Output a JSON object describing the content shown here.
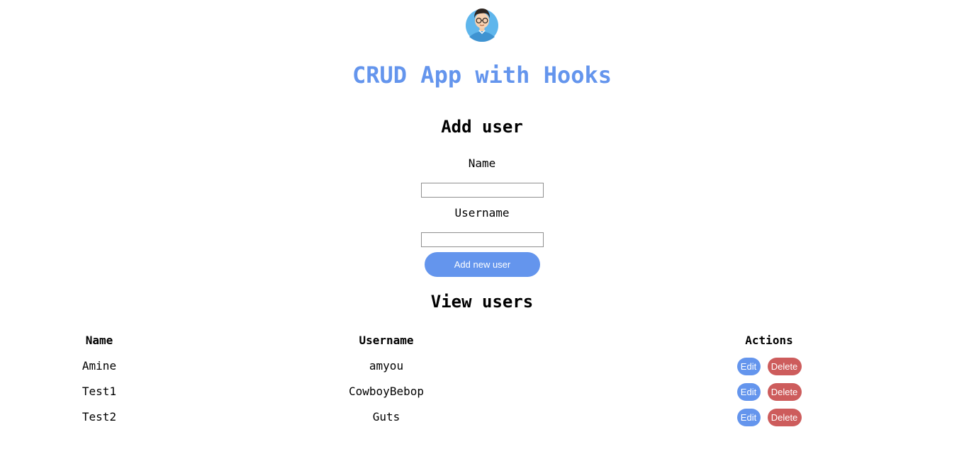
{
  "header": {
    "avatar_icon": "user-avatar-icon",
    "title": "CRUD App with Hooks",
    "accent_color": "#6495ed",
    "danger_color": "#cd5c5c"
  },
  "add_user": {
    "title": "Add user",
    "name_label": "Name",
    "name_value": "",
    "username_label": "Username",
    "username_value": "",
    "submit_label": "Add new user"
  },
  "view_users": {
    "title": "View users",
    "columns": {
      "name": "Name",
      "username": "Username",
      "actions": "Actions"
    },
    "edit_label": "Edit",
    "delete_label": "Delete",
    "rows": [
      {
        "name": "Amine",
        "username": "amyou"
      },
      {
        "name": "Test1",
        "username": "CowboyBebop"
      },
      {
        "name": "Test2",
        "username": "Guts"
      }
    ]
  }
}
